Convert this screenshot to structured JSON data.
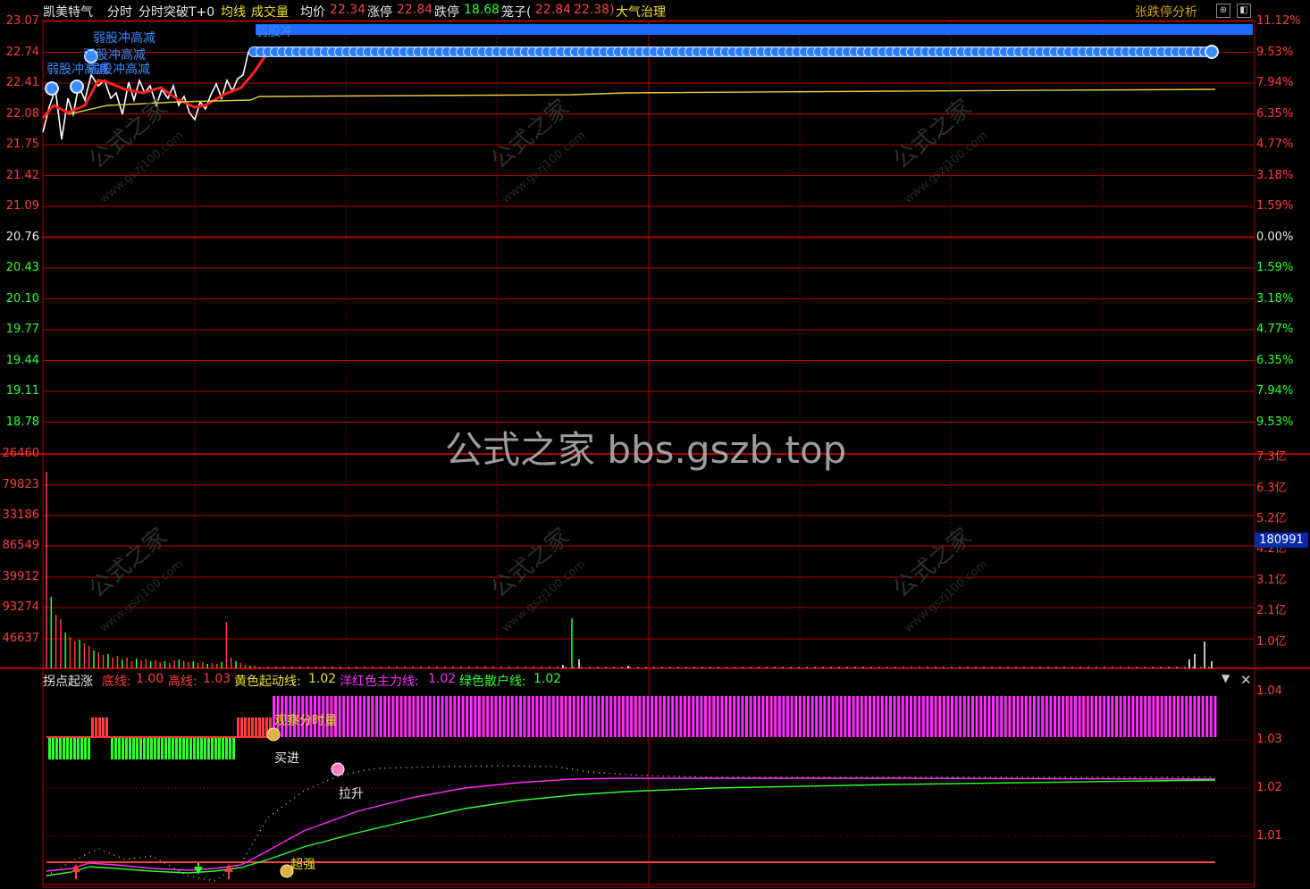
{
  "header": {
    "stock_name": "凯美特气",
    "mode": "分时",
    "formula": "分时突破T+0",
    "avg_line_label": "均线",
    "volume_label": "成交量",
    "avg_price_label": "均价",
    "avg_price": "22.34",
    "limit_up_label": "涨停",
    "limit_up": "22.84",
    "limit_down_label": "跌停",
    "limit_down": "18.68",
    "cage_label": "笼子(",
    "cage_high": "22.84",
    "cage_low": "22.38)",
    "signal": "大气治理",
    "analysis_button": "张跌停分析"
  },
  "price_axis": {
    "left": [
      "23.07",
      "22.74",
      "22.41",
      "22.08",
      "21.75",
      "21.42",
      "21.09",
      "20.76",
      "20.43",
      "20.10",
      "19.77",
      "19.44",
      "19.11",
      "18.78"
    ],
    "right": [
      "11.12%",
      "9.53%",
      "7.94%",
      "6.35%",
      "4.77%",
      "3.18%",
      "1.59%",
      "0.00%",
      "1.59%",
      "3.18%",
      "4.77%",
      "6.35%",
      "7.94%",
      "9.53%"
    ]
  },
  "volume_axis": {
    "left": [
      "26460",
      "79823",
      "33186",
      "86549",
      "39912",
      "93274",
      "46637"
    ],
    "right": [
      "7.3亿",
      "6.3亿",
      "5.2亿",
      "4.2亿",
      "3.1亿",
      "2.1亿",
      "1.0亿"
    ],
    "current_badge": "180991"
  },
  "price_annotations": [
    "弱股冲高减",
    "弱股冲高减",
    "弱股冲高减",
    "弱股冲高减",
    "弱股冲高减"
  ],
  "sub_panel": {
    "title": "拐点起涨",
    "bottom_line_label": "底线:",
    "bottom_line_value": "1.00",
    "high_line_label": "高线:",
    "high_line_value": "1.03",
    "yellow_label": "黄色起动线:",
    "yellow_value": "1.02",
    "magenta_label": "洋红色主力线:",
    "magenta_value": "1.02",
    "green_label": "绿色散户线:",
    "green_value": "1.02",
    "axis": [
      "1.04",
      "1.03",
      "1.02",
      "1.01"
    ],
    "annotations": {
      "watch": "观察分时量",
      "buy": "买进",
      "lift": "拉升",
      "strong": "超强"
    }
  },
  "watermark": "公式之家 bbs.gszb.top",
  "ghost_watermark": "公式之家",
  "ghost_watermark_url": "www.gszj100.com",
  "colors": {
    "grid": "#b00000",
    "axis_up": "#ff3c3c",
    "axis_down": "#1ee11e",
    "price_line": "#ffffff",
    "avg_line": "#e0d040",
    "limit_bar": "#1e6cff",
    "magenta": "#ff2cff",
    "green": "#2cff2c"
  }
}
